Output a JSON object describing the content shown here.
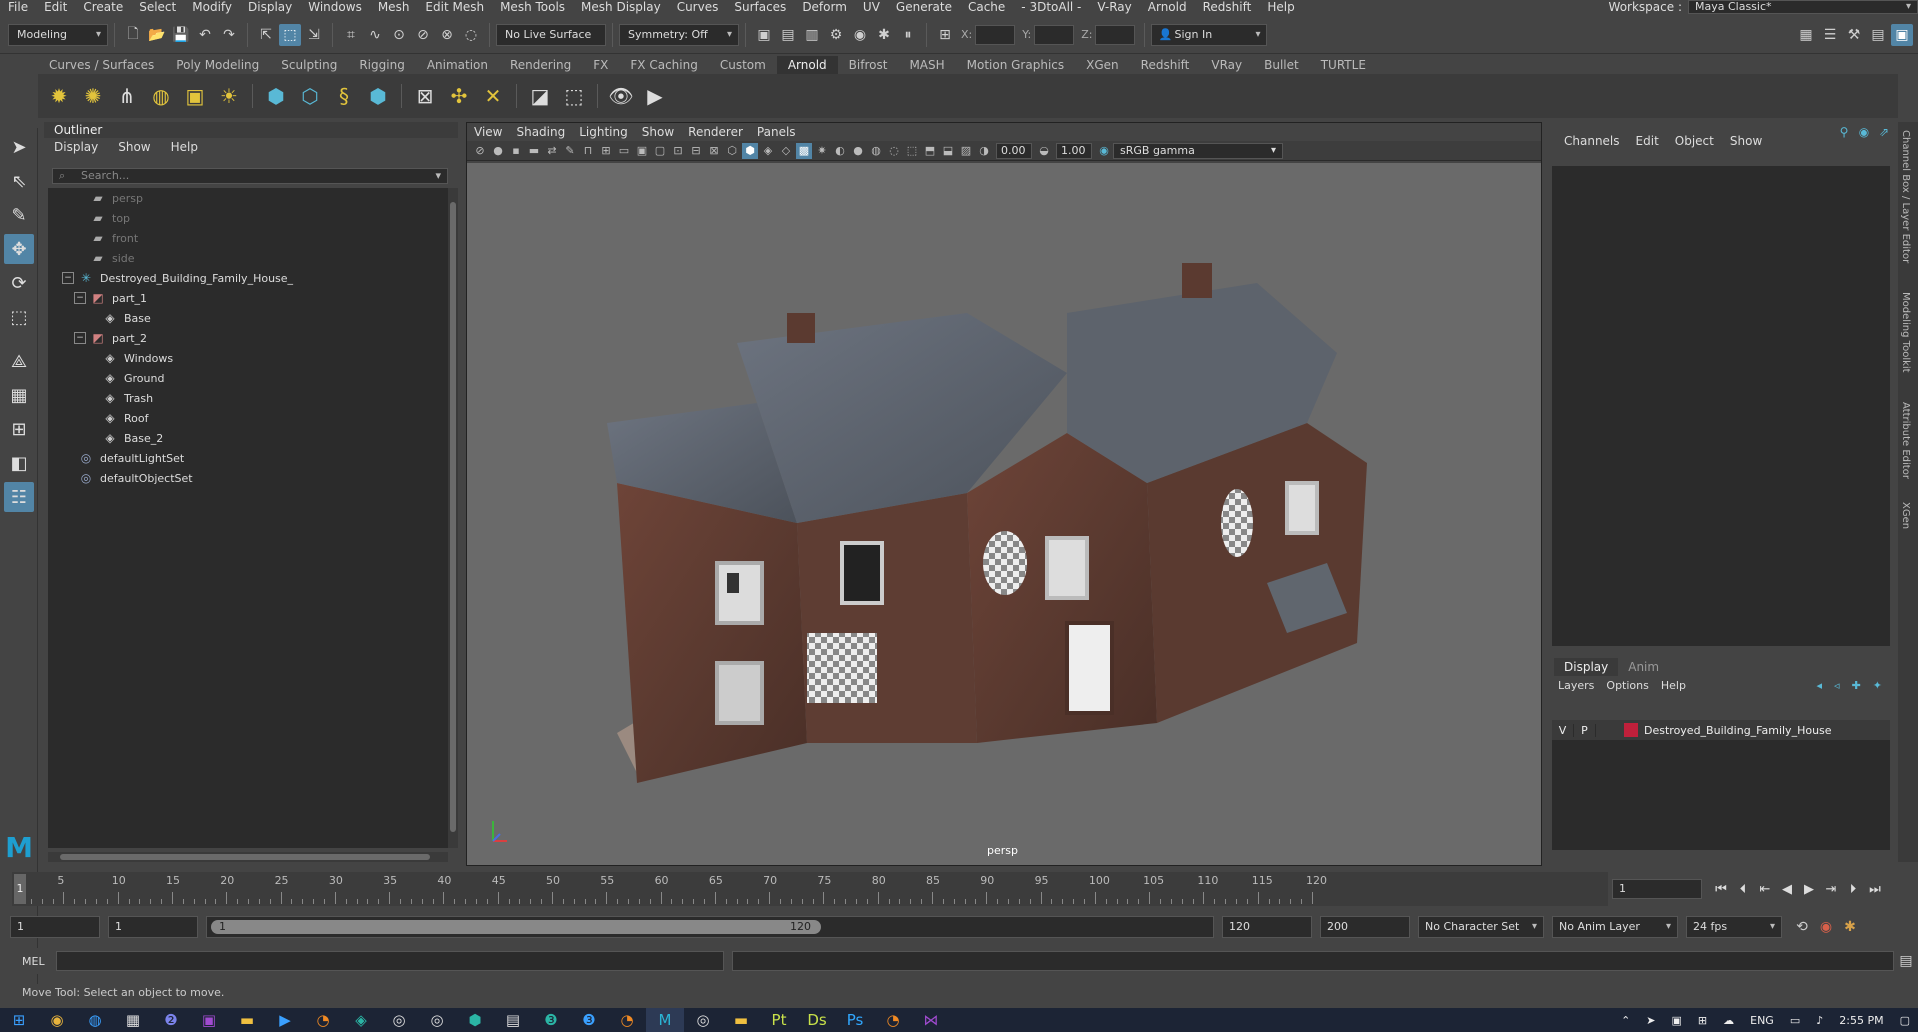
{
  "menubar": {
    "items": [
      "File",
      "Edit",
      "Create",
      "Select",
      "Modify",
      "Display",
      "Windows",
      "Mesh",
      "Edit Mesh",
      "Mesh Tools",
      "Mesh Display",
      "Curves",
      "Surfaces",
      "Deform",
      "UV",
      "Generate",
      "Cache",
      "- 3DtoAll -",
      "V-Ray",
      "Arnold",
      "Redshift",
      "Help"
    ],
    "workspace_label": "Workspace :",
    "workspace_value": "Maya Classic*"
  },
  "statusline": {
    "mode": "Modeling",
    "live_surface": "No Live Surface",
    "symmetry": "Symmetry: Off",
    "axis_x": "X:",
    "axis_y": "Y:",
    "axis_z": "Z:",
    "sign_in": "Sign In"
  },
  "shelf": {
    "tabs": [
      "Curves / Surfaces",
      "Poly Modeling",
      "Sculpting",
      "Rigging",
      "Animation",
      "Rendering",
      "FX",
      "FX Caching",
      "Custom",
      "Arnold",
      "Bifrost",
      "MASH",
      "Motion Graphics",
      "XGen",
      "Redshift",
      "VRay",
      "Bullet",
      "TURTLE"
    ],
    "active_tab": "Arnold"
  },
  "outliner": {
    "title": "Outliner",
    "menu": [
      "Display",
      "Show",
      "Help"
    ],
    "search_placeholder": "Search...",
    "rows": [
      {
        "label": "persp",
        "type": "camera",
        "depth": 1,
        "dim": true
      },
      {
        "label": "top",
        "type": "camera",
        "depth": 1,
        "dim": true
      },
      {
        "label": "front",
        "type": "camera",
        "depth": 1,
        "dim": true
      },
      {
        "label": "side",
        "type": "camera",
        "depth": 1,
        "dim": true
      },
      {
        "label": "Destroyed_Building_Family_House_",
        "type": "group",
        "depth": 0,
        "expand": "−"
      },
      {
        "label": "part_1",
        "type": "transform",
        "depth": 1,
        "expand": "−"
      },
      {
        "label": "Base",
        "type": "mesh",
        "depth": 2
      },
      {
        "label": "part_2",
        "type": "transform",
        "depth": 1,
        "expand": "−"
      },
      {
        "label": "Windows",
        "type": "mesh",
        "depth": 2
      },
      {
        "label": "Ground",
        "type": "mesh",
        "depth": 2
      },
      {
        "label": "Trash",
        "type": "mesh",
        "depth": 2
      },
      {
        "label": "Roof",
        "type": "mesh",
        "depth": 2
      },
      {
        "label": "Base_2",
        "type": "mesh",
        "depth": 2
      },
      {
        "label": "defaultLightSet",
        "type": "set",
        "depth": 0
      },
      {
        "label": "defaultObjectSet",
        "type": "set",
        "depth": 0
      }
    ]
  },
  "viewport": {
    "menu": [
      "View",
      "Shading",
      "Lighting",
      "Show",
      "Renderer",
      "Panels"
    ],
    "exposure": "0.00",
    "gamma": "1.00",
    "color_space": "sRGB gamma",
    "camera": "persp"
  },
  "channelbox": {
    "menu": [
      "Channels",
      "Edit",
      "Object",
      "Show"
    ]
  },
  "layereditor": {
    "tabs": [
      "Display",
      "Anim"
    ],
    "active_tab": "Display",
    "menu": [
      "Layers",
      "Options",
      "Help"
    ],
    "layer": {
      "v": "V",
      "p": "P",
      "name": "Destroyed_Building_Family_House",
      "color": "#c0203b"
    }
  },
  "sidetabs": [
    "Channel Box / Layer Editor",
    "Modeling Toolkit",
    "Attribute Editor",
    "XGen"
  ],
  "timeslider": {
    "ticks": [
      5,
      10,
      15,
      20,
      25,
      30,
      35,
      40,
      45,
      50,
      55,
      60,
      65,
      70,
      75,
      80,
      85,
      90,
      95,
      100,
      105,
      110,
      115,
      120
    ],
    "current": "1",
    "current_field": "1"
  },
  "rangeslider": {
    "start": "1",
    "playback_start": "1",
    "range_start": "1",
    "range_end": "120",
    "playback_end": "120",
    "end": "200",
    "character_set": "No Character Set",
    "anim_layer": "No Anim Layer",
    "fps": "24 fps"
  },
  "cmdline": {
    "label": "MEL"
  },
  "helpline": {
    "text": "Move Tool: Select an object to move."
  },
  "taskbar": {
    "time": "2:55 PM",
    "lang": "ENG"
  }
}
